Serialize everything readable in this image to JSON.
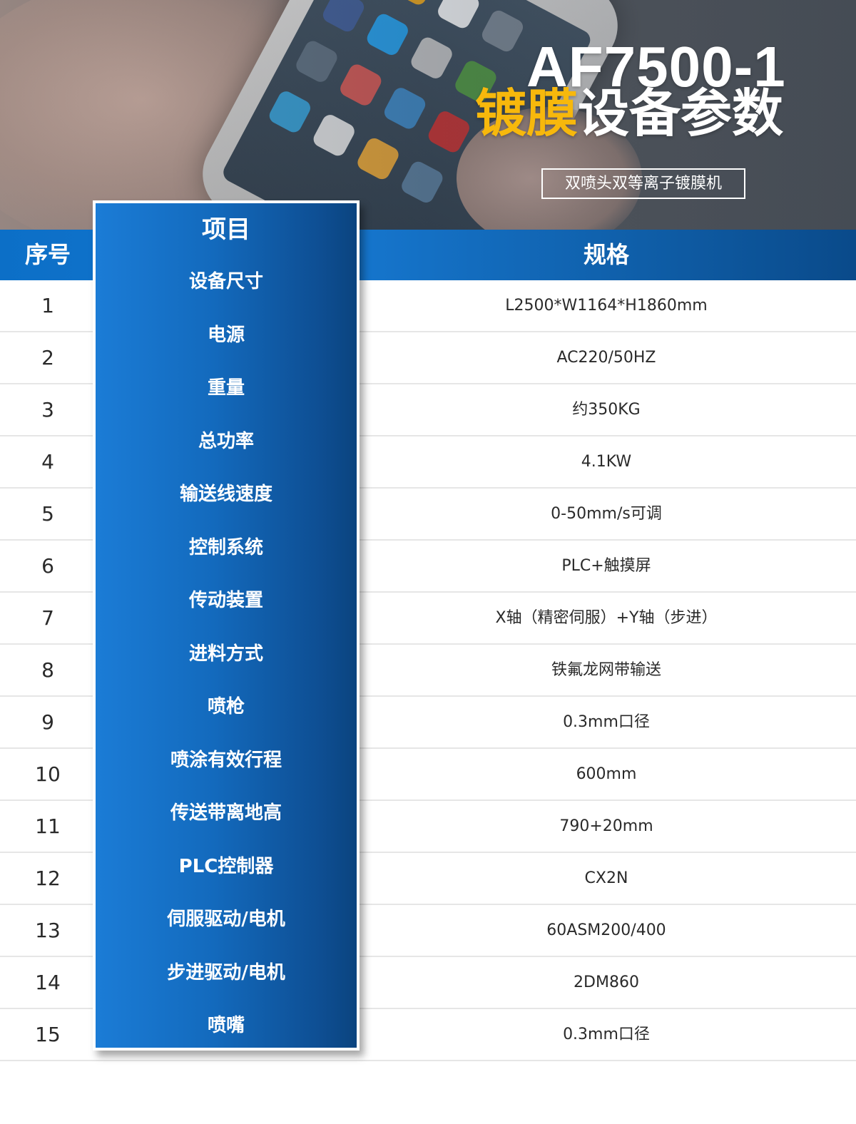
{
  "header": {
    "model": "AF7500-1",
    "title_highlight": "镀膜",
    "title_rest": "设备参数",
    "subtitle": "双喷头双等离子镀膜机"
  },
  "columns": {
    "seq": "序号",
    "item": "项目",
    "spec": "规格"
  },
  "rows": [
    {
      "num": "1",
      "item": "设备尺寸",
      "spec": "L2500*W1164*H1860mm"
    },
    {
      "num": "2",
      "item": "电源",
      "spec": "AC220/50HZ"
    },
    {
      "num": "3",
      "item": "重量",
      "spec": "约350KG"
    },
    {
      "num": "4",
      "item": "总功率",
      "spec": "4.1KW"
    },
    {
      "num": "5",
      "item": "输送线速度",
      "spec": "0-50mm/s可调"
    },
    {
      "num": "6",
      "item": "控制系统",
      "spec": "PLC+触摸屏"
    },
    {
      "num": "7",
      "item": "传动装置",
      "spec": "X轴（精密伺服）+Y轴（步进）"
    },
    {
      "num": "8",
      "item": "进料方式",
      "spec": "铁氟龙网带输送"
    },
    {
      "num": "9",
      "item": "喷枪",
      "spec": "0.3mm口径"
    },
    {
      "num": "10",
      "item": "喷涂有效行程",
      "spec": "600mm"
    },
    {
      "num": "11",
      "item": "传送带离地高",
      "spec": "790+20mm"
    },
    {
      "num": "12",
      "item": "PLC控制器",
      "spec": "CX2N"
    },
    {
      "num": "13",
      "item": "伺服驱动/电机",
      "spec": "60ASM200/400"
    },
    {
      "num": "14",
      "item": "步进驱动/电机",
      "spec": "2DM860"
    },
    {
      "num": "15",
      "item": "喷嘴",
      "spec": "0.3mm口径"
    }
  ],
  "colors": {
    "accent_blue": "#1677cf",
    "title_yellow": "#f7b80c"
  }
}
